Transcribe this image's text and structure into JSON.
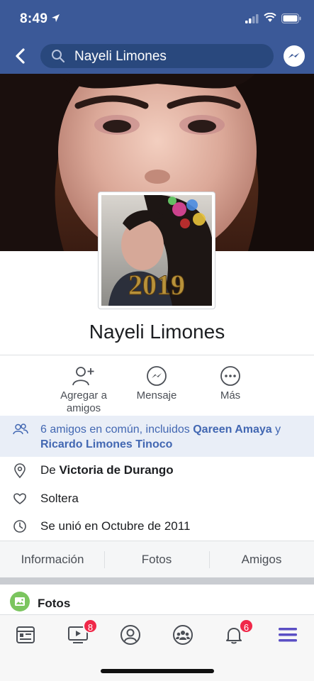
{
  "status": {
    "time": "8:49"
  },
  "search": {
    "query": "Nayeli Limones"
  },
  "profile": {
    "name": "Nayeli Limones",
    "photo_year_text": "2019"
  },
  "actions": {
    "add_friend": "Agregar a amigos",
    "message": "Mensaje",
    "more": "Más"
  },
  "mutual": {
    "prefix": "6 amigos en común, incluidos ",
    "friend1": "Qareen Amaya",
    "joiner": " y ",
    "friend2": "Ricardo Limones Tinoco"
  },
  "info": {
    "from_prefix": "De ",
    "from_place": "Victoria de Durango",
    "relationship": "Soltera",
    "joined": "Se unió en Octubre de 2011"
  },
  "tabs": {
    "info": "Información",
    "photos": "Fotos",
    "friends": "Amigos"
  },
  "photos_section": {
    "title": "Fotos"
  },
  "tab_bar": {
    "items": [
      {
        "icon": "news-feed-icon",
        "badge": ""
      },
      {
        "icon": "watch-icon",
        "badge": "8"
      },
      {
        "icon": "profile-icon",
        "badge": ""
      },
      {
        "icon": "groups-icon",
        "badge": ""
      },
      {
        "icon": "notifications-icon",
        "badge": "6"
      },
      {
        "icon": "menu-icon",
        "badge": ""
      }
    ]
  },
  "colors": {
    "brand": "#3b5998",
    "link": "#4267b2",
    "badge": "#f02849",
    "menu_active": "#5b4fc4"
  }
}
